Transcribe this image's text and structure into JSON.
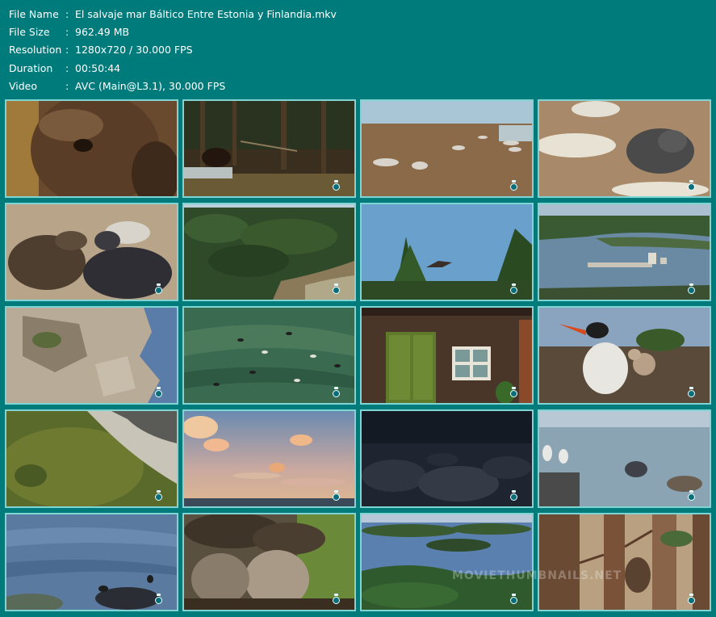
{
  "info": [
    {
      "label": "File Name",
      "sep": ":",
      "value": "El salvaje mar Báltico Entre Estonia y Finlandia.mkv"
    },
    {
      "label": "File Size",
      "sep": ":",
      "value": "962.49 MB"
    },
    {
      "label": "Resolution",
      "sep": ":",
      "value": "1280x720 / 30.000 FPS"
    },
    {
      "label": "Duration",
      "sep": ":",
      "value": "00:50:44"
    },
    {
      "label": "Video",
      "sep": ":",
      "value": "AVC (Main@L3.1), 30.000 FPS"
    }
  ],
  "thumbnails": [
    {
      "scene": "moose-closeup"
    },
    {
      "scene": "moose-forest"
    },
    {
      "scene": "seals-beach"
    },
    {
      "scene": "seal-closeup"
    },
    {
      "scene": "seals-fighting"
    },
    {
      "scene": "forest-aerial"
    },
    {
      "scene": "bird-flying-trees"
    },
    {
      "scene": "coastal-town-aerial"
    },
    {
      "scene": "limestone-cliff"
    },
    {
      "scene": "ducks-water"
    },
    {
      "scene": "wooden-house"
    },
    {
      "scene": "tern-nest"
    },
    {
      "scene": "shallow-water-shore"
    },
    {
      "scene": "sunset-sky"
    },
    {
      "scene": "dark-rocks"
    },
    {
      "scene": "gulls-seals-sea"
    },
    {
      "scene": "sea-rocks-birds"
    },
    {
      "scene": "owl-chick"
    },
    {
      "scene": "lake-islands-aerial"
    },
    {
      "scene": "owl-pine-trees"
    }
  ],
  "watermark": "MOVIETHUMBNAILS.NET"
}
